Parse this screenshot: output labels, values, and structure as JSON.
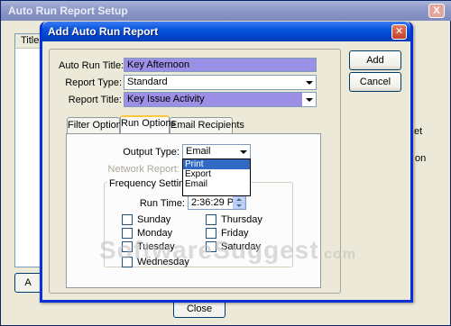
{
  "outer_window": {
    "title": "Auto Run Report Setup",
    "close_glyph": "X",
    "list_header": "Title",
    "side_text_1": "et",
    "side_text_2": "on",
    "left_button_label": "A",
    "close_button_label": "Close"
  },
  "dialog": {
    "title": "Add Auto Run Report",
    "close_glyph": "✕",
    "fields": {
      "auto_run_title_label": "Auto Run Title:",
      "auto_run_title_value": "Key Afternoon",
      "report_type_label": "Report Type:",
      "report_type_value": "Standard",
      "report_title_label": "Report Title:",
      "report_title_value": "Key Issue Activity"
    },
    "buttons": {
      "add": "Add",
      "cancel": "Cancel"
    },
    "tabs": [
      {
        "label": "Filter Options",
        "active": false
      },
      {
        "label": "Run Options",
        "active": true
      },
      {
        "label": "Email Recipients",
        "active": false
      }
    ],
    "run_options": {
      "output_type_label": "Output Type:",
      "output_type_value": "Email",
      "output_type_options": [
        "Print",
        "Export",
        "Email"
      ],
      "output_type_highlighted": "Print",
      "network_report_label": "Network Report:",
      "frequency_legend": "Frequency Settings",
      "run_time_label": "Run Time:",
      "run_time_value": "2:36:29 PM",
      "days": [
        {
          "label": "Sunday",
          "checked": false
        },
        {
          "label": "Monday",
          "checked": false
        },
        {
          "label": "Tuesday",
          "checked": false
        },
        {
          "label": "Wednesday",
          "checked": false
        },
        {
          "label": "Thursday",
          "checked": false
        },
        {
          "label": "Friday",
          "checked": false
        },
        {
          "label": "Saturday",
          "checked": false
        }
      ]
    }
  },
  "watermark": {
    "text": "SoftwareSuggest",
    "suffix": ".com"
  },
  "colors": {
    "dialog_title_blue": "#0855dd",
    "highlight_field": "#9b8fe6",
    "selection": "#316ac5",
    "tab_accent": "#ffc83c"
  }
}
